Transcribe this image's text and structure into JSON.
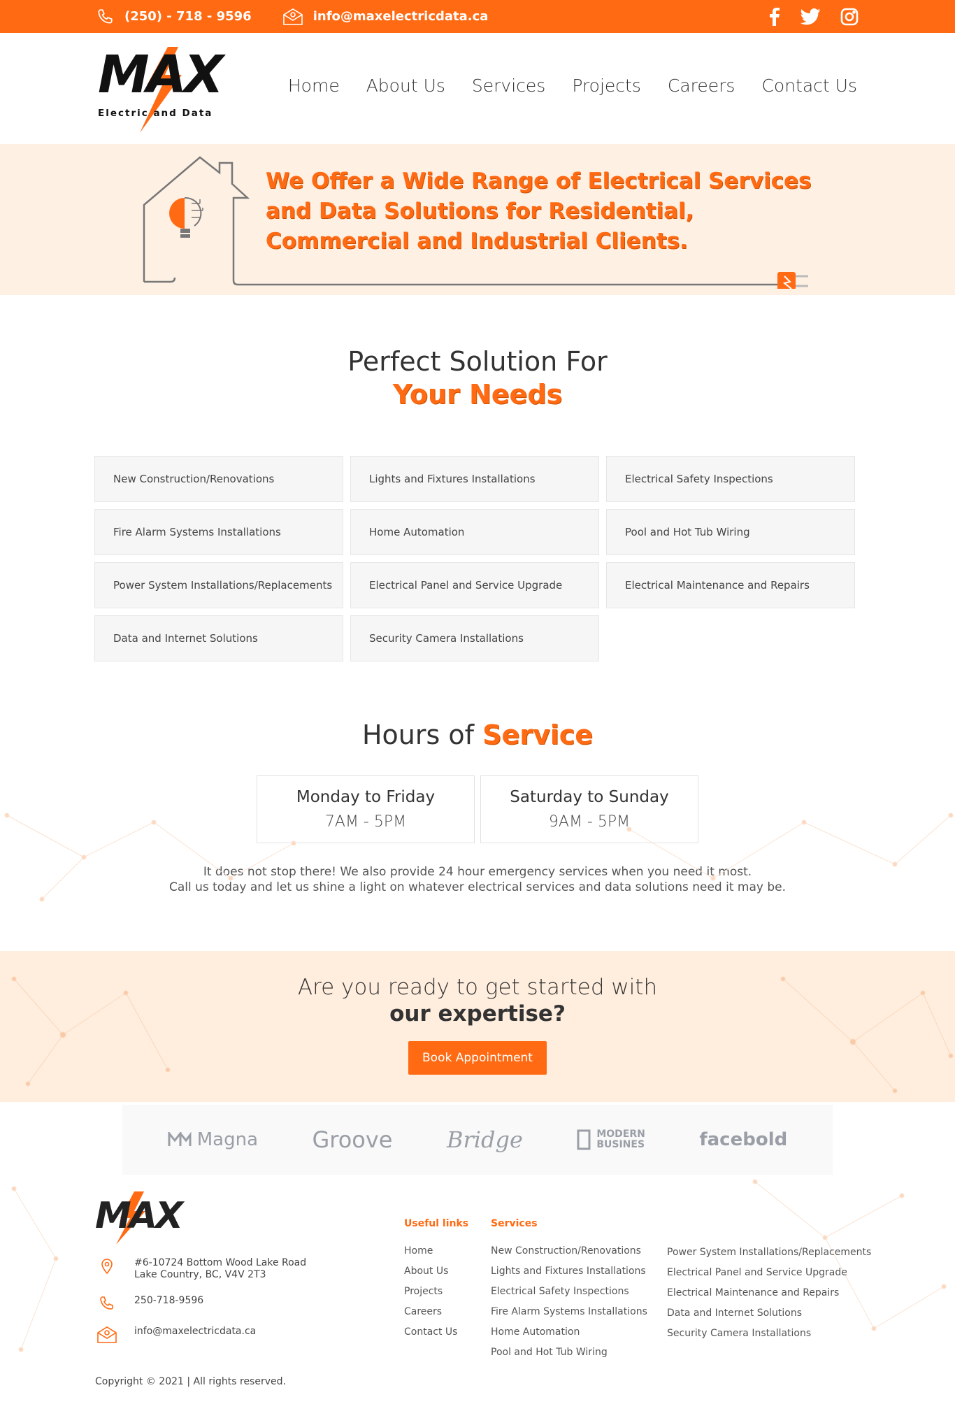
{
  "colors": {
    "accent": "#ff6a13",
    "banner_bg": "#fff0e4",
    "cta_bg": "#ffeede"
  },
  "topbar": {
    "phone": "(250) - 718 - 9596",
    "email": "info@maxelectricdata.ca",
    "social": [
      "facebook-icon",
      "twitter-icon",
      "instagram-icon"
    ]
  },
  "logo": {
    "mark": "MAX",
    "tagline": "Electric and Data"
  },
  "nav": [
    "Home",
    "About Us",
    "Services",
    "Projects",
    "Careers",
    "Contact Us"
  ],
  "banner": {
    "headline": "We Offer a Wide Range of Electrical Services and Data Solutions for Residential, Commercial and Industrial Clients."
  },
  "solutions": {
    "title_plain": "Perfect Solution For",
    "title_accent": "Your Needs",
    "items": [
      "New Construction/Renovations",
      "Lights and Fixtures Installations",
      "Electrical Safety Inspections",
      "Fire Alarm Systems Installations",
      "Home Automation",
      "Pool and Hot Tub Wiring",
      "Power System Installations/Replacements",
      "Electrical Panel and Service Upgrade",
      "Electrical Maintenance and Repairs",
      "Data and Internet Solutions",
      "Security Camera Installations"
    ]
  },
  "hours": {
    "title_plain": "Hours of",
    "title_accent": "Service",
    "cards": [
      {
        "day": "Monday to Friday",
        "time": "7AM - 5PM"
      },
      {
        "day": "Saturday to Sunday",
        "time": "9AM - 5PM"
      }
    ],
    "note_1": "It does not stop there! We also provide 24 hour emergency services when you need it most.",
    "note_2": "Call us today and let us shine a light on whatever electrical services and data solutions need it may be."
  },
  "cta": {
    "line_1": "Are you ready to get started with",
    "line_2": "our expertise?",
    "button": "Book Appointment"
  },
  "partners": [
    "Magna",
    "Groove",
    "Bridge",
    "MODERN",
    "BUSINES",
    "facebold"
  ],
  "footer": {
    "address_1": "#6-10724 Bottom Wood Lake Road",
    "address_2": "Lake Country, BC, V4V 2T3",
    "phone": "250-718-9596",
    "email": "info@maxelectricdata.ca",
    "copyright": "Copyright © 2021  |  All rights reserved.",
    "useful_title": "Useful links",
    "useful_links": [
      "Home",
      "About Us",
      "Projects",
      "Careers",
      "Contact Us"
    ],
    "services_title": "Services",
    "services_col1": [
      "New Construction/Renovations",
      "Lights and Fixtures Installations",
      "Electrical Safety Inspections",
      "Fire Alarm Systems Installations",
      "Home Automation",
      "Pool and Hot Tub Wiring"
    ],
    "services_col2": [
      "Power System Installations/Replacements",
      "Electrical Panel and Service Upgrade",
      "Electrical Maintenance and Repairs",
      "Data and Internet Solutions",
      "Security Camera Installations"
    ]
  }
}
